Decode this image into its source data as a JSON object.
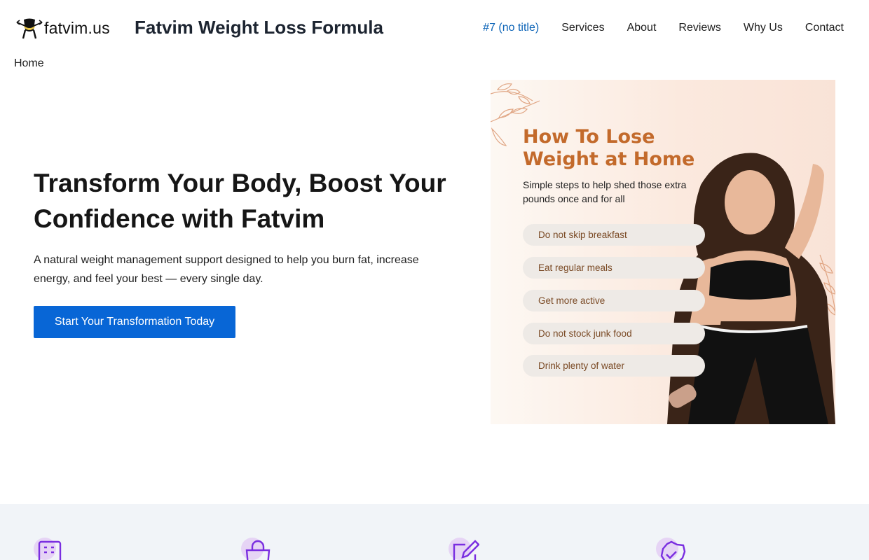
{
  "header": {
    "logo_text": "fatvim.us",
    "site_title": "Fatvim Weight Loss Formula",
    "nav": [
      {
        "label": "#7 (no title)"
      },
      {
        "label": "Services"
      },
      {
        "label": "About"
      },
      {
        "label": "Reviews"
      },
      {
        "label": "Why Us"
      },
      {
        "label": "Contact"
      }
    ]
  },
  "breadcrumb": "Home",
  "hero": {
    "heading": "Transform Your Body, Boost Your Confidence with Fatvim",
    "text": "A natural weight management support designed to help you burn fat, increase energy, and feel your best — every single day.",
    "cta_label": "Start Your Transformation Today"
  },
  "hero_image": {
    "title": "How To Lose Weight at Home",
    "subtitle": "Simple steps to help shed those extra pounds once and for all",
    "tips": [
      "Do not skip breakfast",
      "Eat regular meals",
      "Get more active",
      "Do not stock junk food",
      "Drink plenty of water"
    ]
  },
  "features": {
    "icons": [
      "document-icon",
      "shopping-bag-icon",
      "edit-icon",
      "badge-check-icon"
    ]
  },
  "colors": {
    "accent": "#0866d6",
    "active_nav": "#0b63b7",
    "feature_bg": "#f1f4f8",
    "icon_purple": "#7a2ee0",
    "image_title": "#c36a2b"
  }
}
